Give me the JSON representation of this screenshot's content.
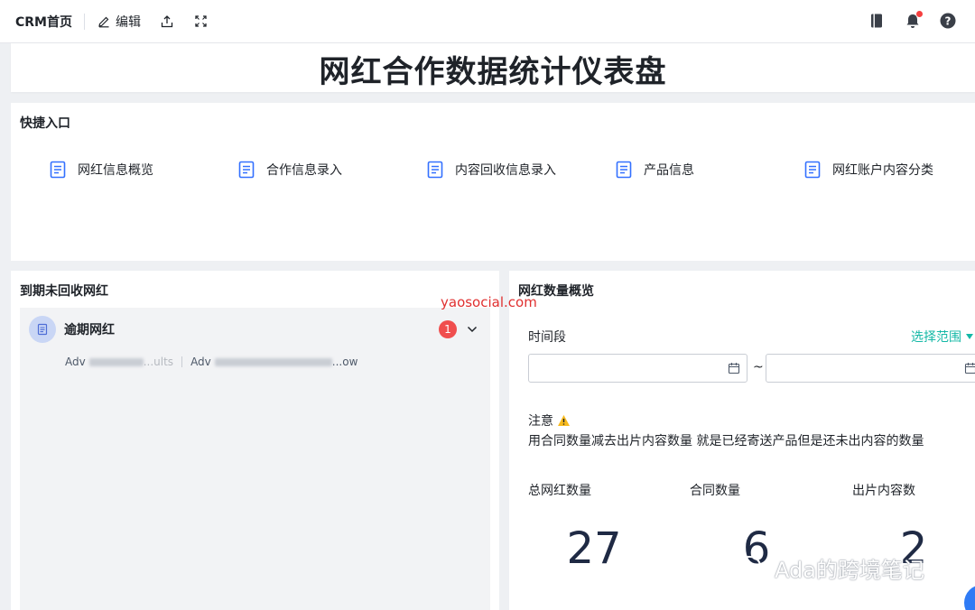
{
  "topbar": {
    "app_title": "CRM首页",
    "edit_label": "编辑",
    "icons": [
      "edit-icon",
      "share-icon",
      "fullscreen-icon",
      "book-icon",
      "bell-icon",
      "help-icon"
    ]
  },
  "dashboard": {
    "title": "网红合作数据统计仪表盘"
  },
  "quick_entry": {
    "heading": "快捷入口",
    "items": [
      {
        "label": "网红信息概览",
        "icon": "document-icon"
      },
      {
        "label": "合作信息录入",
        "icon": "document-icon"
      },
      {
        "label": "内容回收信息录入",
        "icon": "document-icon"
      },
      {
        "label": "产品信息",
        "icon": "document-icon"
      },
      {
        "label": "网红账户内容分类",
        "icon": "document-icon"
      }
    ]
  },
  "overdue": {
    "heading": "到期未回收网红",
    "card_title": "逾期网红",
    "badge_count": "1",
    "entries": [
      {
        "prefix": "Adv",
        "suffix": "...ults"
      },
      {
        "prefix": "Adv",
        "suffix": "...ow"
      }
    ]
  },
  "overview": {
    "heading": "网红数量概览",
    "period_label": "时间段",
    "range_link": "选择范围",
    "start_date": {
      "value": "",
      "placeholder": ""
    },
    "end_date": {
      "value": "",
      "placeholder": ""
    },
    "separator": "~",
    "note_title": "注意",
    "note_text": "用合同数量减去出片内容数量 就是已经寄送产品但是还未出内容的数量",
    "stats": [
      {
        "label": "总网红数量",
        "value": "27"
      },
      {
        "label": "合同数量",
        "value": "6"
      },
      {
        "label": "出片内容数",
        "value": "2"
      }
    ]
  },
  "watermarks": {
    "site": "yaosocial.com",
    "wechat": "Ada的跨境笔记"
  },
  "colors": {
    "accent_blue": "#3370ff",
    "link_teal": "#14b8a6",
    "badge_red": "#f04e4e",
    "warning_yellow": "#f7ba1e"
  }
}
